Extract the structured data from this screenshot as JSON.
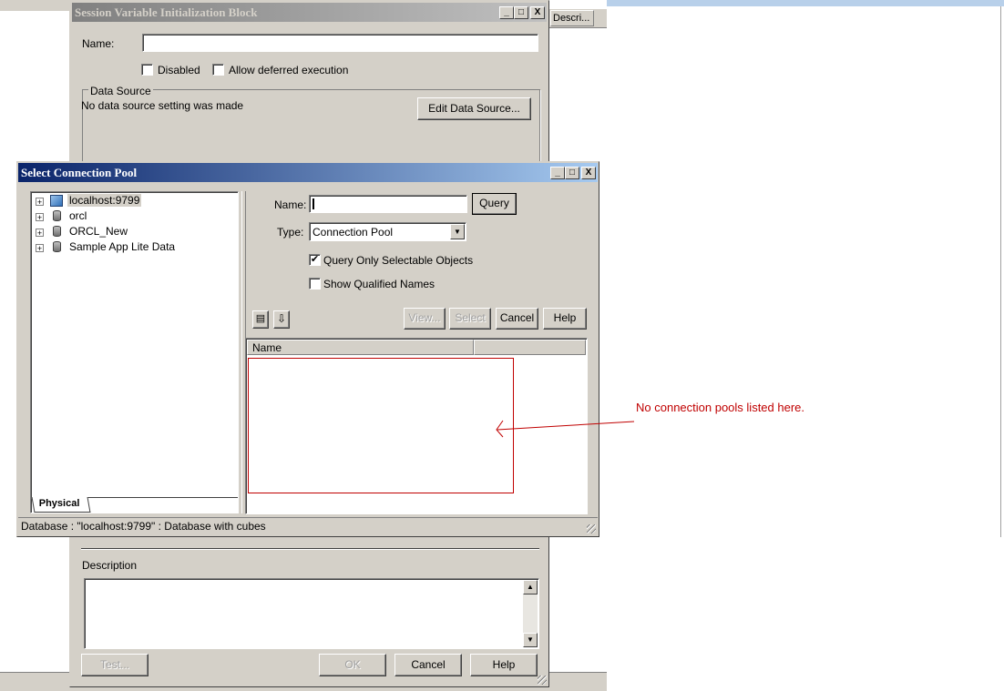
{
  "background_window": {
    "top_strip_color": "#d4d0c8",
    "right_column_header": "Descri...",
    "session_dialog": {
      "title": "Session Variable Initialization Block",
      "title_controls": [
        "_",
        "□",
        "X"
      ],
      "name_label": "Name:",
      "name_value": "",
      "disabled_label": "Disabled",
      "deferred_label": "Allow deferred execution",
      "data_source_group": "Data Source",
      "data_source_text": "No data source setting was made",
      "edit_data_source_button": "Edit Data Source...",
      "description_label": "Description",
      "test_button": "Test...",
      "ok_button": "OK",
      "cancel_button": "Cancel",
      "help_button": "Help"
    }
  },
  "select_pool_dialog": {
    "title": "Select Connection Pool",
    "title_controls": [
      "_",
      "□",
      "X"
    ],
    "tree": [
      {
        "label": "localhost:9799",
        "icon": "cube-database-icon",
        "selected": true
      },
      {
        "label": "orcl",
        "icon": "database-icon",
        "selected": false
      },
      {
        "label": "ORCL_New",
        "icon": "database-icon",
        "selected": false
      },
      {
        "label": "Sample App Lite Data",
        "icon": "database-icon",
        "selected": false
      }
    ],
    "tree_tab": "Physical",
    "name_label": "Name:",
    "name_value": "",
    "query_button": "Query",
    "type_label": "Type:",
    "type_value": "Connection Pool",
    "query_only_label": "Query Only Selectable Objects",
    "query_only_checked": true,
    "show_qualified_label": "Show Qualified Names",
    "show_qualified_checked": false,
    "view_button": "View...",
    "select_button": "Select",
    "cancel_button": "Cancel",
    "help_button": "Help",
    "results_columns": [
      "Name",
      ""
    ],
    "results_rows": [],
    "status_text": "Database : \"localhost:9799\" : Database with cubes"
  },
  "annotation": {
    "text": "No connection pools listed here.",
    "color": "#c00000"
  }
}
